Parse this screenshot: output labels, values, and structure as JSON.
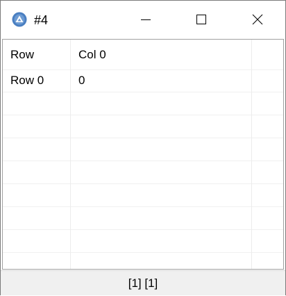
{
  "window": {
    "title": "#4",
    "icon": "app-logo-icon",
    "controls": {
      "minimize": "minimize-icon",
      "maximize": "maximize-icon",
      "close": "close-icon"
    }
  },
  "table": {
    "headers": [
      "Row",
      "Col 0",
      ""
    ],
    "rows": [
      [
        "Row 0",
        "0",
        ""
      ]
    ]
  },
  "status": {
    "text": "[1] [1]"
  },
  "colors": {
    "accent": "#4a7fc1",
    "border": "#a0a0a0",
    "statusbar": "#f0f0f0"
  }
}
